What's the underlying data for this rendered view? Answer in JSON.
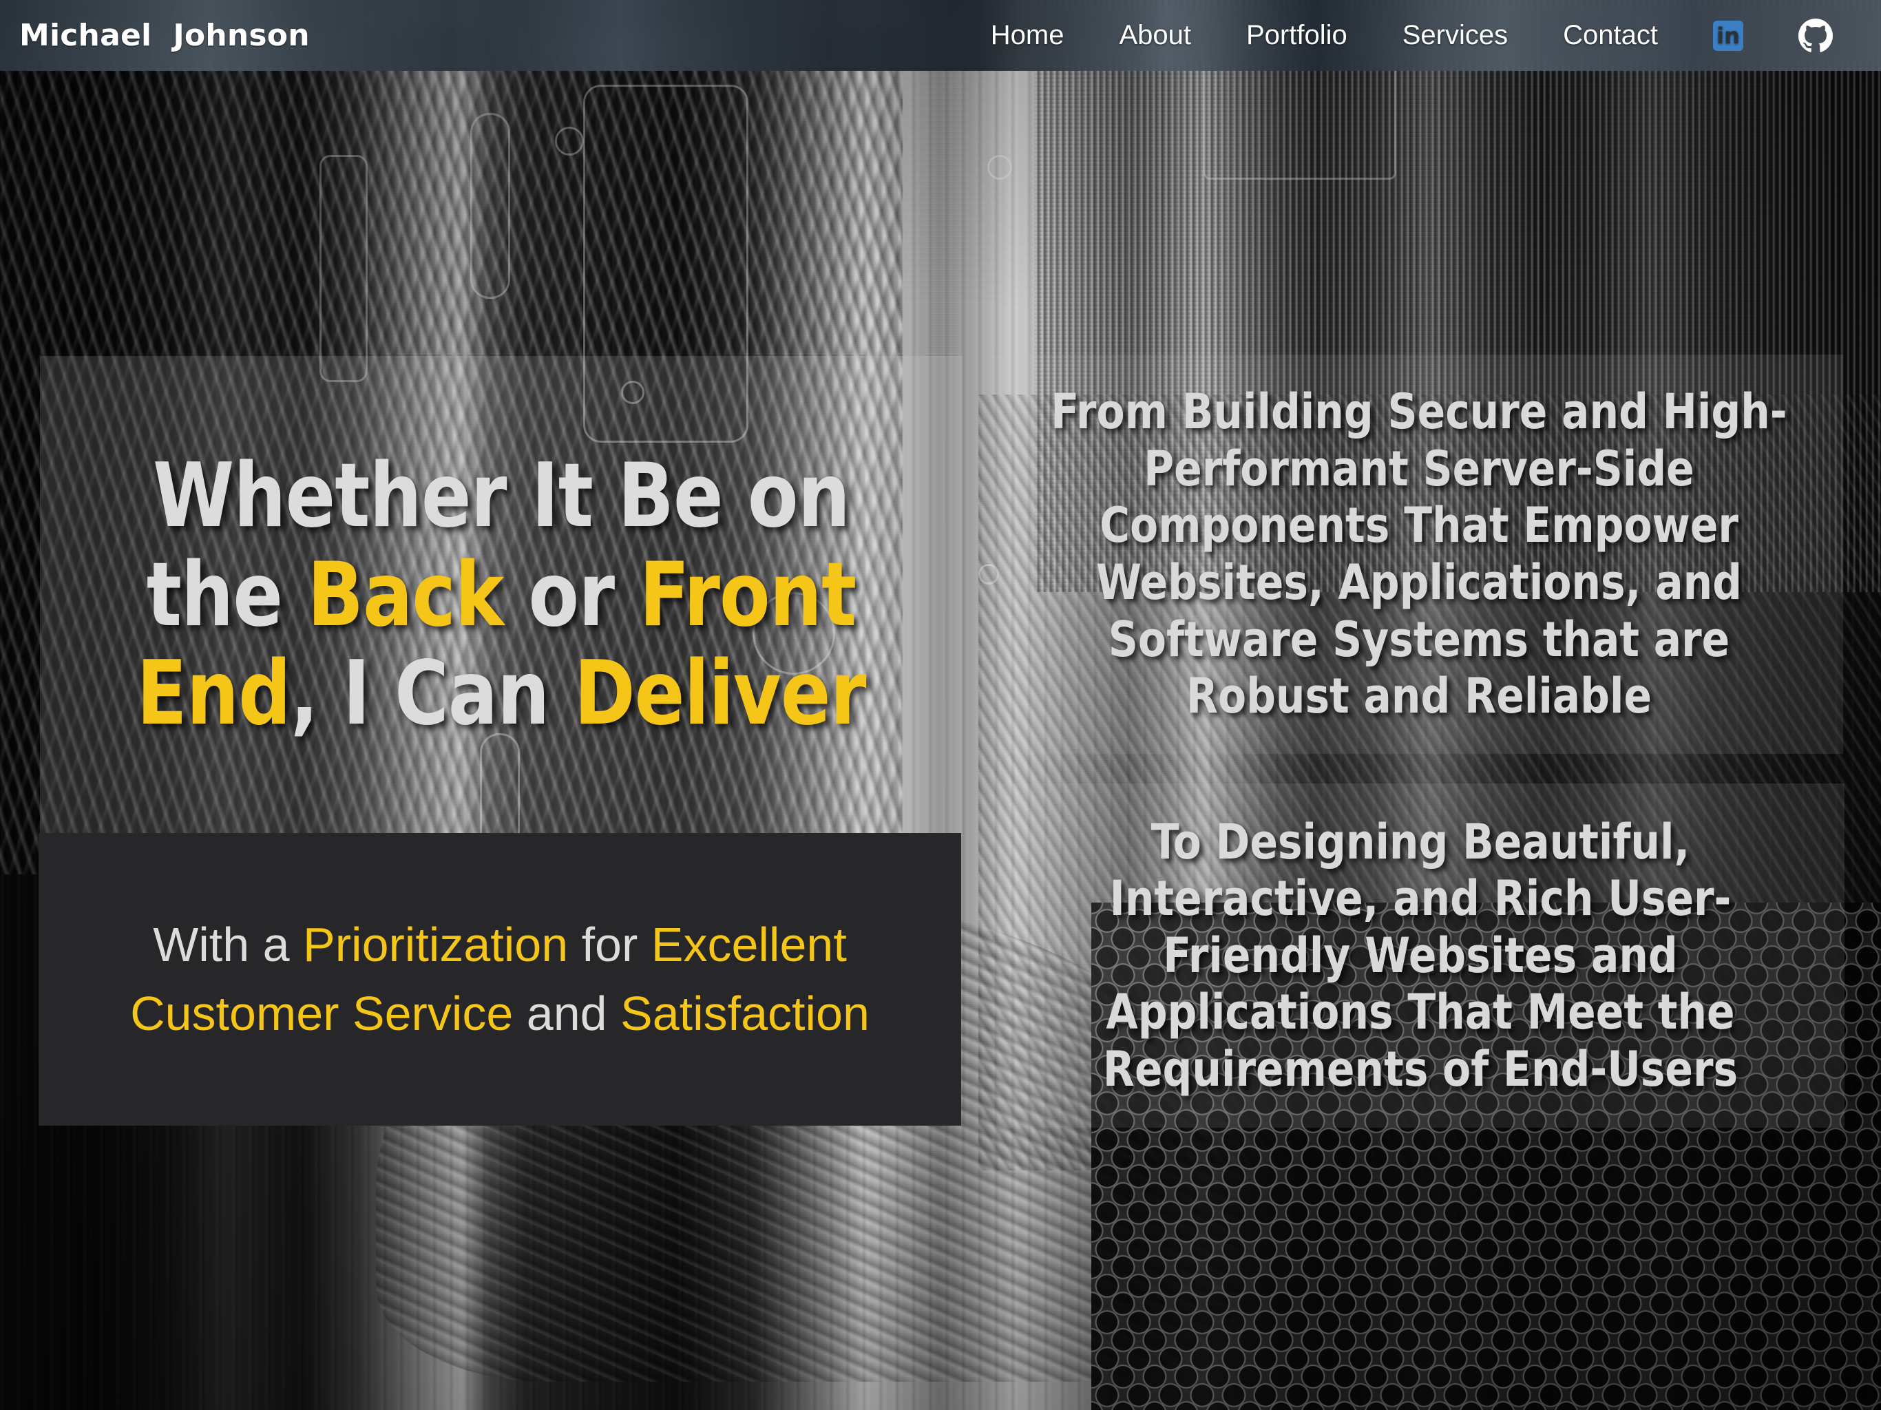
{
  "site": {
    "logo": "Michael  Johnson"
  },
  "nav": {
    "items": [
      {
        "label": "Home"
      },
      {
        "label": "About"
      },
      {
        "label": "Portfolio"
      },
      {
        "label": "Services"
      },
      {
        "label": "Contact"
      }
    ],
    "social": [
      {
        "name": "linkedin-icon",
        "glyph": "in"
      },
      {
        "name": "github-icon",
        "glyph": ""
      }
    ]
  },
  "hero": {
    "headline": {
      "parts": [
        {
          "text": "Whether It Be on the ",
          "highlight": false
        },
        {
          "text": "Back",
          "highlight": true
        },
        {
          "text": " or ",
          "highlight": false
        },
        {
          "text": "Front End",
          "highlight": true
        },
        {
          "text": ", I Can ",
          "highlight": false
        },
        {
          "text": "Deliver",
          "highlight": true
        }
      ],
      "plain": "Whether It Be on the Back or Front End, I Can Deliver"
    },
    "subtitle": {
      "parts": [
        {
          "text": "With a ",
          "highlight": false
        },
        {
          "text": "Prioritization",
          "highlight": true
        },
        {
          "text": " for ",
          "highlight": false
        },
        {
          "text": "Excellent Customer Service",
          "highlight": true
        },
        {
          "text": " and ",
          "highlight": false
        },
        {
          "text": "Satisfaction",
          "highlight": true
        }
      ],
      "plain": "With a Prioritization for Excellent Customer Service and Satisfaction"
    },
    "panels": [
      {
        "text": "From Building Secure and High-Performant Server-Side Components That Empower Websites, Applications, and Software Systems that are Robust and Reliable"
      },
      {
        "text": "To Designing Beautiful, Interactive, and Rich User-Friendly Websites and Applications That Meet the Requirements of End-Users"
      }
    ]
  },
  "colors": {
    "accent_yellow": "#F5C518",
    "text_light": "#DCDCDC",
    "panel_dark": "#27272A",
    "linkedin_blue": "#3B7FC4",
    "header_tint": "#2E3842"
  }
}
